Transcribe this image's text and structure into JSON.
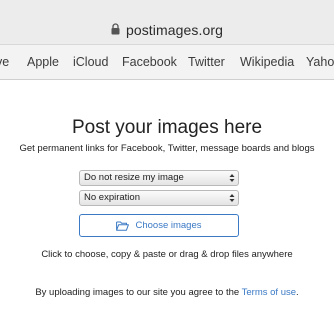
{
  "browser": {
    "url": "postimages.org",
    "bookmarks": [
      "ve",
      "Apple",
      "iCloud",
      "Facebook",
      "Twitter",
      "Wikipedia",
      "Yaho"
    ]
  },
  "main": {
    "title": "Post your images here",
    "subtitle": "Get permanent links for Facebook, Twitter, message boards and blogs",
    "resize_select": {
      "selected": "Do not resize my image"
    },
    "expiration_select": {
      "selected": "No expiration"
    },
    "choose_button_label": "Choose images",
    "hint": "Click to choose, copy & paste or drag & drop files anywhere",
    "terms_prefix": "By uploading images to our site you agree to the ",
    "terms_link": "Terms of use",
    "terms_suffix": "."
  },
  "icons": {
    "lock": "lock-icon",
    "folder": "folder-open-icon",
    "select_arrows": "updown-arrows-icon"
  },
  "colors": {
    "accent": "#3b79c5",
    "chrome_bg": "#ececec",
    "bookmarks_bg": "#f3f3f3",
    "text": "#222222"
  }
}
